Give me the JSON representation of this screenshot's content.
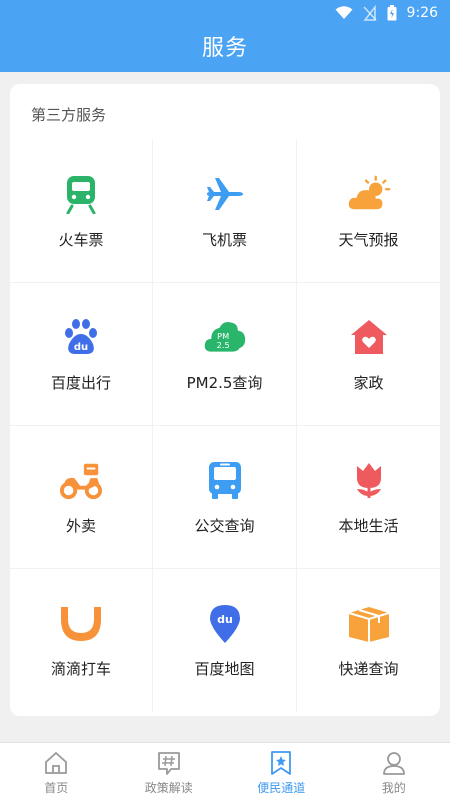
{
  "status_bar": {
    "time": "9:26"
  },
  "header": {
    "title": "服务"
  },
  "section": {
    "title": "第三方服务",
    "items": [
      {
        "label": "火车票",
        "icon": "train-icon",
        "color": "#2bb36a"
      },
      {
        "label": "飞机票",
        "icon": "airplane-icon",
        "color": "#3d9df2"
      },
      {
        "label": "天气预报",
        "icon": "weather-icon",
        "color": "#f7a23b"
      },
      {
        "label": "百度出行",
        "icon": "baidu-paw-icon",
        "color": "#3f6ee8"
      },
      {
        "label": "PM2.5查询",
        "icon": "pm25-cloud-icon",
        "color": "#29b66b",
        "icon_text": "PM 2.5"
      },
      {
        "label": "家政",
        "icon": "home-heart-icon",
        "color": "#ee5a5e"
      },
      {
        "label": "外卖",
        "icon": "scooter-icon",
        "color": "#f7923a"
      },
      {
        "label": "公交查询",
        "icon": "bus-icon",
        "color": "#3d9df2"
      },
      {
        "label": "本地生活",
        "icon": "tulip-icon",
        "color": "#ee5a5e"
      },
      {
        "label": "滴滴打车",
        "icon": "didi-icon",
        "color": "#f7923a"
      },
      {
        "label": "百度地图",
        "icon": "map-pin-icon",
        "color": "#3f6ee8",
        "icon_text": "du"
      },
      {
        "label": "快递查询",
        "icon": "package-icon",
        "color": "#f7a23b"
      }
    ]
  },
  "tabbar": {
    "active_color": "#3f9af0",
    "tabs": [
      {
        "label": "首页",
        "icon": "home-icon",
        "active": false
      },
      {
        "label": "政策解读",
        "icon": "hashtag-chat-icon",
        "active": false
      },
      {
        "label": "便民通道",
        "icon": "star-bookmark-icon",
        "active": true
      },
      {
        "label": "我的",
        "icon": "user-icon",
        "active": false
      }
    ]
  }
}
